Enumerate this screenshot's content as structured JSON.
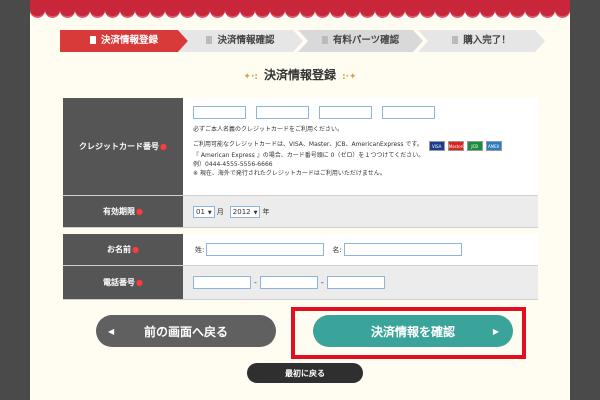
{
  "steps": [
    {
      "label": "決済情報登録"
    },
    {
      "label": "決済情報確認"
    },
    {
      "label": "有料パーツ確認"
    },
    {
      "label": "購入完了！"
    }
  ],
  "page_title": "決済情報登録",
  "form": {
    "credit_card": {
      "label": "クレジットカード番号",
      "notes": [
        "必ずご本人名義のクレジットカードをご利用ください。",
        "ご利用可能なクレジットカードは、VISA、Master、JCB、AmericanExpress です。",
        "『 American Express 』の場合、カード番号頭に 0（ゼロ）を１つつけてください。",
        "例）0444-4555-5556-6666",
        "※ 現在、海外で発行されたクレジットカードはご利用いただけません。"
      ],
      "card_brands": [
        "VISA",
        "MasterCard",
        "JCB",
        "AMEX"
      ]
    },
    "expiry": {
      "label": "有効期限",
      "month": "01",
      "month_unit": "月",
      "year": "2012",
      "year_unit": "年"
    },
    "name": {
      "label": "お名前",
      "sei_label": "姓:",
      "mei_label": "名:"
    },
    "phone": {
      "label": "電話番号",
      "separator": "-"
    },
    "required_mark": "●"
  },
  "buttons": {
    "back": "前の画面へ戻る",
    "confirm": "決済情報を確認",
    "start_over": "最初に戻る",
    "back_arrow": "◀",
    "confirm_arrow": "▶"
  },
  "colors": {
    "active_step": "#d83a3a",
    "confirm_button": "#3aa39a",
    "highlight_border": "#e01020"
  }
}
